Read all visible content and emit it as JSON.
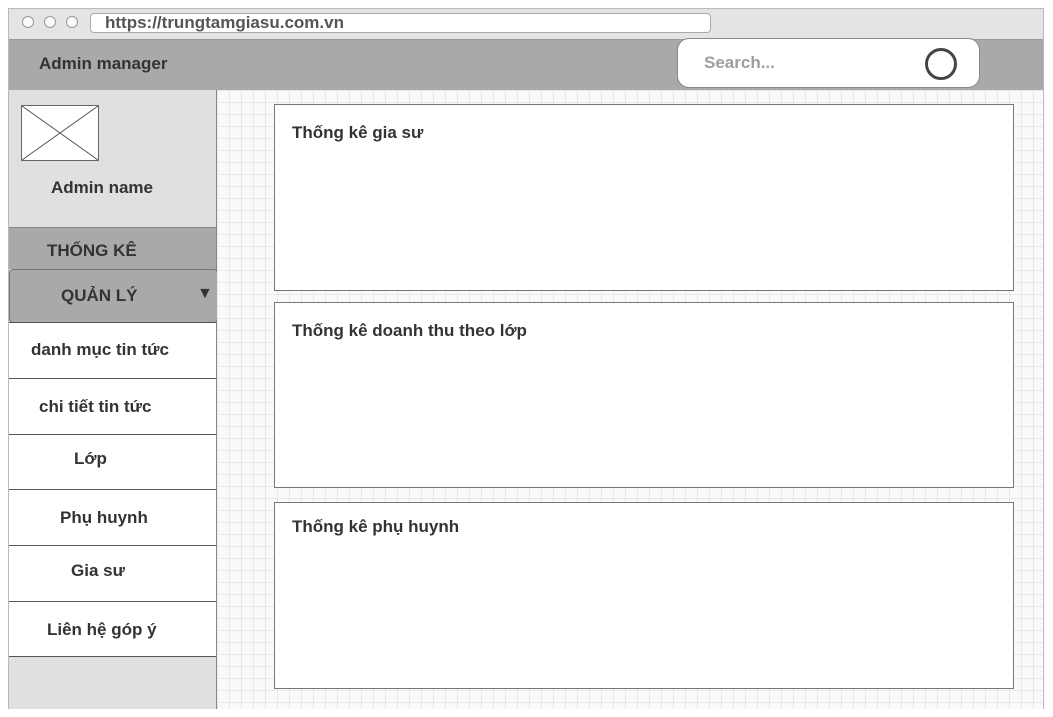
{
  "browser": {
    "url": "https://trungtamgiasu.com.vn"
  },
  "header": {
    "app_title": "Admin manager",
    "search": {
      "placeholder": "Search..."
    }
  },
  "sidebar": {
    "admin_name": "Admin name",
    "stats_label": "THỐNG KÊ",
    "manage_label": "QUẢN LÝ",
    "manage_caret": "▼",
    "items": [
      {
        "label": "danh mục tin tức"
      },
      {
        "label": "chi tiết tin tức"
      },
      {
        "label": "Lớp"
      },
      {
        "label": "Phụ huynh"
      },
      {
        "label": "Gia sư"
      },
      {
        "label": "Liên hệ góp ý"
      }
    ]
  },
  "main": {
    "cards": [
      {
        "title": "Thống kê gia sư"
      },
      {
        "title": "Thống kê doanh thu theo lớp"
      },
      {
        "title": "Thống kê phụ huynh"
      }
    ]
  }
}
